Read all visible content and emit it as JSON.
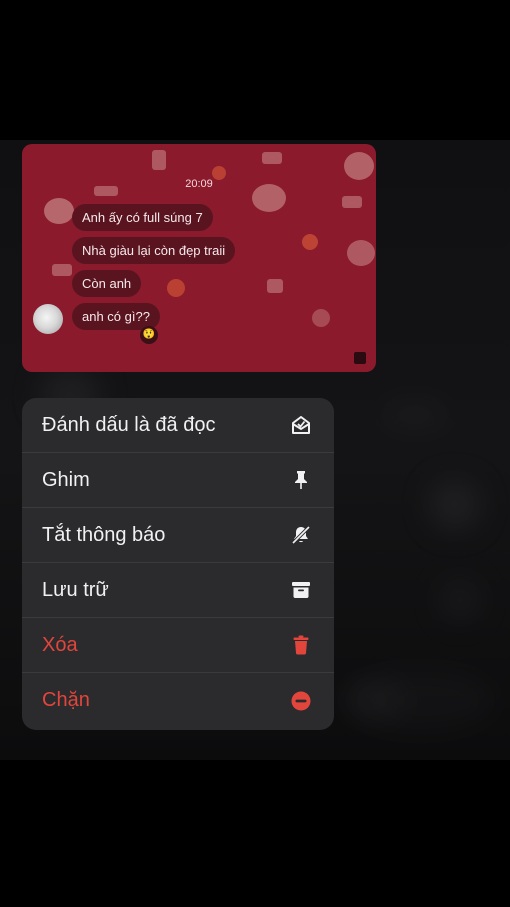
{
  "chat": {
    "timestamp": "20:09",
    "messages": [
      "Anh ấy có full súng 7",
      "Nhà giàu lại còn đẹp traii",
      "Còn anh",
      "anh có gì??"
    ],
    "reaction_emoji": "😲"
  },
  "menu": {
    "items": [
      {
        "label": "Đánh dấu là đã đọc",
        "icon": "mark-read-envelope-icon",
        "destructive": false
      },
      {
        "label": "Ghim",
        "icon": "pin-icon",
        "destructive": false
      },
      {
        "label": "Tắt thông báo",
        "icon": "bell-off-icon",
        "destructive": false
      },
      {
        "label": "Lưu trữ",
        "icon": "archive-icon",
        "destructive": false
      },
      {
        "label": "Xóa",
        "icon": "trash-icon",
        "destructive": true
      },
      {
        "label": "Chặn",
        "icon": "block-icon",
        "destructive": true
      }
    ]
  },
  "colors": {
    "chat_background": "#8a1a2c",
    "bubble": "#5a1420",
    "menu_background": "#2b2b2d",
    "destructive": "#e2453c"
  }
}
